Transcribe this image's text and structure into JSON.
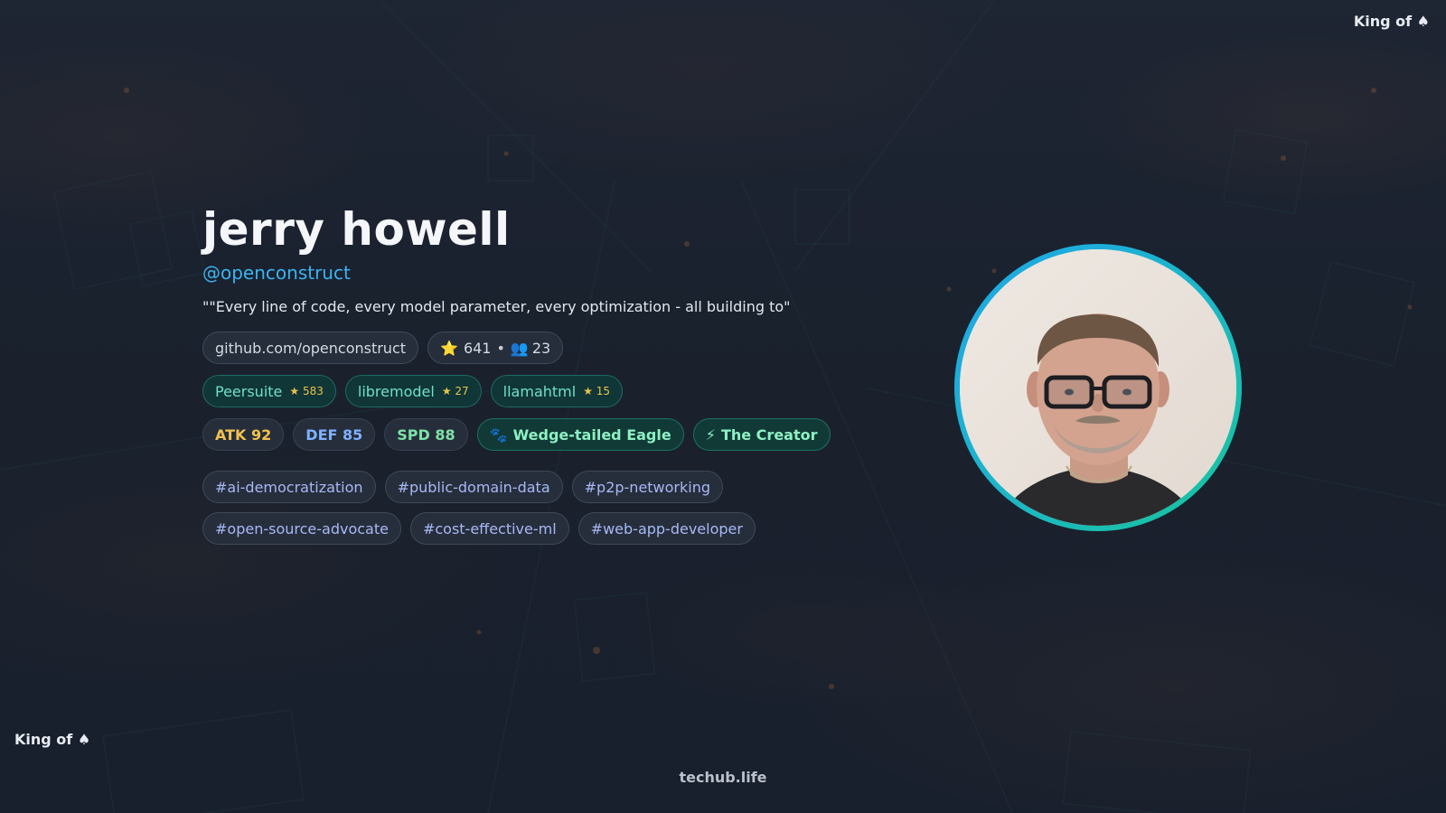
{
  "corner_label": "King of ♠",
  "profile": {
    "name": "jerry howell",
    "handle": "@openconstruct",
    "quote": "\"\"Every line of code, every model parameter, every optimization - all building to\"",
    "github": "github.com/openconstruct",
    "stars": "641",
    "followers": "23",
    "stats_separator": "•"
  },
  "repos": [
    {
      "name": "Peersuite",
      "stars": "★ 583"
    },
    {
      "name": "libremodel",
      "stars": "★ 27"
    },
    {
      "name": "llamahtml",
      "stars": "★ 15"
    }
  ],
  "stats": [
    {
      "label": "ATK 92",
      "color": "#f2c14e"
    },
    {
      "label": "DEF 85",
      "color": "#7fb2ff"
    },
    {
      "label": "SPD 88",
      "color": "#7ee2a8"
    }
  ],
  "badges": [
    {
      "icon": "🐾",
      "label": "Wedge-tailed Eagle"
    },
    {
      "icon": "⚡",
      "label": "The Creator"
    }
  ],
  "tags": [
    "#ai-democratization",
    "#public-domain-data",
    "#p2p-networking",
    "#open-source-advocate",
    "#cost-effective-ml",
    "#web-app-developer"
  ],
  "footer": "techub.life",
  "colors": {
    "handle": "#3bb4f0",
    "avatar_ring_start": "#1ea6e8",
    "avatar_ring_end": "#17c69a",
    "repo_text": "#6fe0c8",
    "tag_text": "#a8b8f5"
  }
}
